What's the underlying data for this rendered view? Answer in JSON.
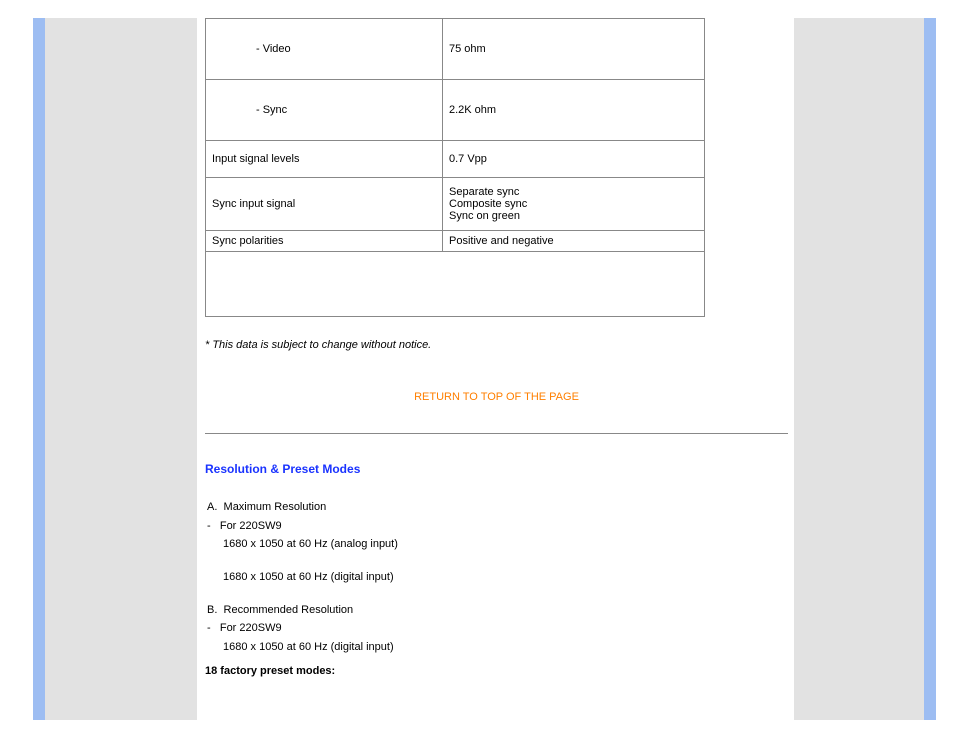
{
  "spec_table": {
    "rows": [
      {
        "label": "- Video",
        "value": "75 ohm",
        "indent": true
      },
      {
        "label": "- Sync",
        "value": "2.2K ohm",
        "indent": true
      },
      {
        "label": "Input signal levels",
        "value": "0.7 Vpp"
      },
      {
        "label": "Sync input signal",
        "value": "Separate sync\nComposite sync\nSync on green"
      },
      {
        "label": "Sync polarities",
        "value": "Positive and negative"
      }
    ]
  },
  "footnote": "* This data is subject to change without notice.",
  "return_link": "RETURN TO TOP OF THE PAGE",
  "section_title": "Resolution & Preset Modes",
  "res_a": {
    "letter": "A.",
    "title": "Maximum Resolution",
    "for": "For 220SW9",
    "line1": "1680 x 1050 at 60 Hz (analog input)",
    "line2": "1680 x 1050 at 60 Hz (digital input)"
  },
  "res_b": {
    "letter": "B.",
    "title": "Recommended Resolution",
    "for": "For 220SW9",
    "line1": "1680 x 1050 at 60 Hz (digital input)"
  },
  "preset_modes": "18 factory preset modes:"
}
